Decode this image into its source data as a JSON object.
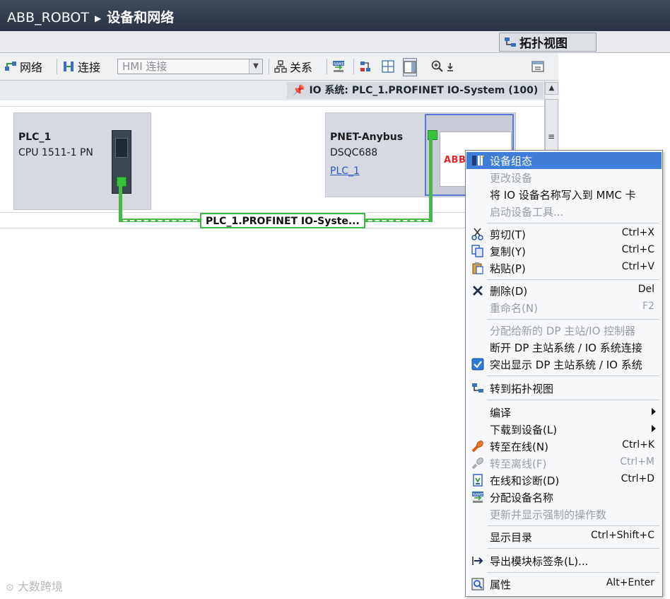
{
  "breadcrumb": {
    "project": "ABB_ROBOT",
    "page": "设备和网络"
  },
  "view_tab": {
    "label": "拓扑视图"
  },
  "toolbar": {
    "network_label": "网络",
    "connect_label": "连接",
    "connection_type_value": "HMI 连接",
    "relation_label": "关系"
  },
  "io_system_label": "IO 系统: PLC_1.PROFINET IO-System (100)",
  "devices": [
    {
      "name": "PLC_1",
      "model": "CPU 1511-1 PN"
    },
    {
      "name": "PNET-Anybus",
      "model": "DSQC688",
      "link": "PLC_1",
      "logo": "ABB"
    }
  ],
  "network_label": "PLC_1.PROFINET IO-Syste...",
  "context_menu": {
    "items": [
      {
        "label": "设备组态",
        "shortcut": "",
        "icon": "device-config-icon",
        "state": "selected"
      },
      {
        "label": "更改设备",
        "shortcut": "",
        "icon": "",
        "state": "disabled"
      },
      {
        "label": "将 IO 设备名称写入到 MMC 卡",
        "shortcut": "",
        "icon": "",
        "state": "normal"
      },
      {
        "label": "启动设备工具...",
        "shortcut": "",
        "icon": "",
        "state": "disabled"
      },
      {
        "label": "剪切(T)",
        "shortcut": "Ctrl+X",
        "icon": "scissors-icon",
        "state": "normal"
      },
      {
        "label": "复制(Y)",
        "shortcut": "Ctrl+C",
        "icon": "copy-icon",
        "state": "normal"
      },
      {
        "label": "粘贴(P)",
        "shortcut": "Ctrl+V",
        "icon": "paste-icon",
        "state": "normal"
      },
      {
        "label": "删除(D)",
        "shortcut": "Del",
        "icon": "delete-x-icon",
        "state": "normal"
      },
      {
        "label": "重命名(N)",
        "shortcut": "F2",
        "icon": "",
        "state": "disabled"
      },
      {
        "label": "分配给新的 DP 主站/IO 控制器",
        "shortcut": "",
        "icon": "",
        "state": "disabled"
      },
      {
        "label": "断开 DP 主站系统 / IO 系统连接",
        "shortcut": "",
        "icon": "",
        "state": "normal"
      },
      {
        "label": "突出显示 DP 主站系统 / IO 系统",
        "shortcut": "",
        "icon": "checkbox-checked-icon",
        "state": "normal"
      },
      {
        "label": "转到拓扑视图",
        "shortcut": "",
        "icon": "topology-icon",
        "state": "normal"
      },
      {
        "label": "编译",
        "shortcut": "",
        "icon": "",
        "state": "submenu"
      },
      {
        "label": "下载到设备(L)",
        "shortcut": "",
        "icon": "",
        "state": "submenu"
      },
      {
        "label": "转至在线(N)",
        "shortcut": "Ctrl+K",
        "icon": "go-online-icon",
        "state": "normal"
      },
      {
        "label": "转至离线(F)",
        "shortcut": "Ctrl+M",
        "icon": "go-offline-icon",
        "state": "disabled"
      },
      {
        "label": "在线和诊断(D)",
        "shortcut": "Ctrl+D",
        "icon": "diagnostics-icon",
        "state": "normal"
      },
      {
        "label": "分配设备名称",
        "shortcut": "",
        "icon": "assign-name-icon",
        "state": "normal"
      },
      {
        "label": "更新并显示强制的操作数",
        "shortcut": "",
        "icon": "",
        "state": "disabled"
      },
      {
        "label": "显示目录",
        "shortcut": "Ctrl+Shift+C",
        "icon": "",
        "state": "normal"
      },
      {
        "label": "导出模块标签条(L)...",
        "shortcut": "",
        "icon": "export-arrow-icon",
        "state": "normal"
      },
      {
        "label": "属性",
        "shortcut": "Alt+Enter",
        "icon": "properties-icon",
        "state": "normal"
      }
    ]
  },
  "watermark": "大数跨境",
  "colors": {
    "title_bar": "#2b3344",
    "selection": "#3e7ed8",
    "profinet_line": "#44b948",
    "device_box": "#d6d8e2",
    "abb_red": "#e0242c"
  }
}
